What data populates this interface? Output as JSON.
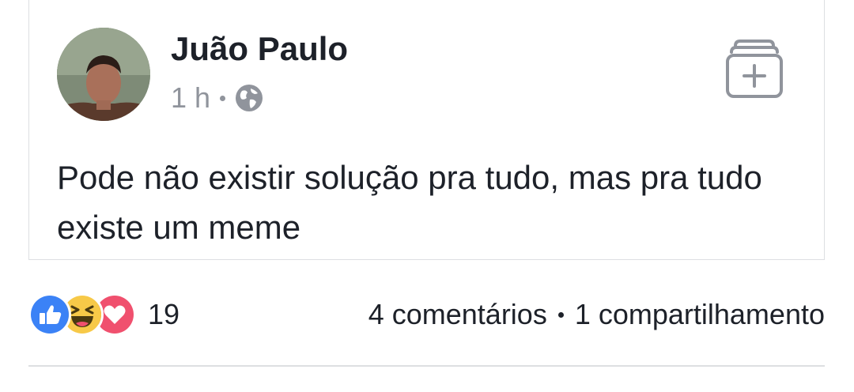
{
  "post": {
    "author": "Juão Paulo",
    "timestamp": "1 h",
    "privacy_icon": "globe-icon",
    "text": "Pode não existir solução pra tudo, mas pra tudo existe um meme",
    "save_icon": "save-to-collection-icon"
  },
  "reactions": {
    "types": [
      "like",
      "haha",
      "love"
    ],
    "count": "19",
    "colors": {
      "like": "#3b82f6",
      "haha": "#f7c948",
      "love": "#f0506e"
    }
  },
  "engagement": {
    "comments": "4 comentários",
    "shares": "1 compartilhamento"
  }
}
